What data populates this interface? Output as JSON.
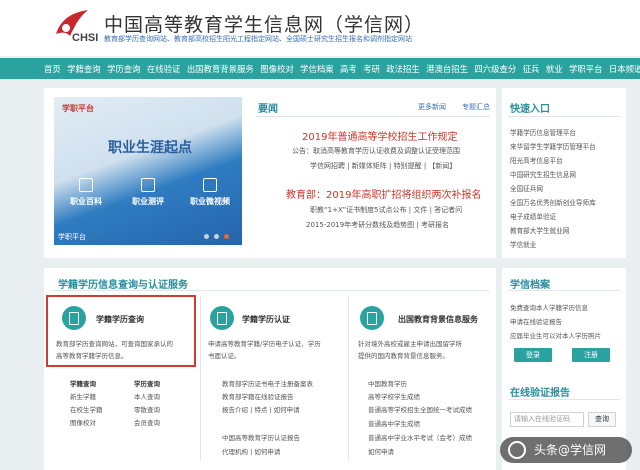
{
  "header": {
    "logo": "CHSI",
    "title": "中国高等教育学生信息网（学信网）",
    "subtitle": "教育部学历查询网站、教育部高校招生阳光工程指定网站、全国硕士研究生招生报名和调剂指定网站"
  },
  "nav": [
    "首页",
    "学籍查询",
    "学历查询",
    "在线验证",
    "出国教育背景服务",
    "图像校对",
    "学信档案",
    "高考",
    "考研",
    "政法招生",
    "港澳台招生",
    "四六级查分",
    "征兵",
    "就业",
    "学职平台",
    "日本频道"
  ],
  "banner": {
    "brand": "学职平台",
    "headline": "职业生涯起点",
    "cards": [
      "职业百科",
      "职业测评",
      "职业微视频"
    ],
    "bottom": "学职平台"
  },
  "news": {
    "title": "要闻",
    "more": "更多新闻",
    "topics": "专题汇总",
    "items": [
      {
        "text": "2019年普通高等学校招生工作规定",
        "style": "red"
      },
      {
        "text": "公告：取消高等教育学历认证收费及调整认证受理范围",
        "style": "dark"
      },
      {
        "text": "学信网招聘 | 新媒体矩阵 | 特别提醒 | 【新闻】",
        "style": "dark"
      },
      {
        "text": "教育部：2019年高职扩招将组织两次补报名",
        "style": "red"
      },
      {
        "text": "职教“1+X”证书制度5试点公布 | 文件 | 答记者问",
        "style": "dark"
      },
      {
        "text": "2015-2019年考研分数线及趋势图 | 考研报名",
        "style": "dark"
      }
    ]
  },
  "quick": {
    "title": "快速入口",
    "items": [
      "学籍学历信息管理平台",
      "来华留学生学籍学历管理平台",
      "阳光高考信息平台",
      "中国研究生招生信息网",
      "全国征兵网",
      "全国万名优秀创新创业导师库",
      "电子成绩单验证",
      "教育部大学生就业网",
      "学信就业"
    ]
  },
  "services": {
    "title": "学籍学历信息查询与认证服务",
    "s1": {
      "title": "学籍学历查询",
      "desc1": "教育部学历查询网站，可查询国家承认的",
      "desc2": "高等教育学籍学历信息。"
    },
    "s2": {
      "title": "学籍学历认证",
      "desc1": "申请高等教育学籍/学历电子认证、学历",
      "desc2": "书面认证。"
    },
    "s3": {
      "title": "出国教育背景信息服务",
      "desc1": "针对境外高校或雇主申请出国留学所",
      "desc2": "提供的国内教育背景信息服务。"
    },
    "col1": [
      "学籍查询",
      "新生学籍",
      "在校生学籍",
      "图像校对"
    ],
    "col2": [
      "学历查询",
      "本人查询",
      "零散查询",
      "会员查询"
    ],
    "s2links": [
      "教育部学历证书电子注册备案表",
      "教育部学籍在线验证报告",
      "报告介绍 | 特点 | 如何申请",
      "中国高等教育学历认证报告",
      "代理机构 | 如何申请"
    ],
    "s3links": [
      "中国教育学历",
      "高等学校学生成绩",
      "普通高等学校招生全国统一考试成绩",
      "普通高中学生成绩",
      "普通高中学业水平考试（会考）成绩",
      "如何申请"
    ]
  },
  "archive": {
    "title": "学信档案",
    "lines": [
      "免费查询本人学籍学历信息",
      "申请在线验证报告",
      "应届毕业生可以对本人学历照片"
    ],
    "login": "登录",
    "register": "注册"
  },
  "verify": {
    "title": "在线验证报告",
    "placeholder": "请输入在线验证码",
    "query": "查询"
  },
  "watermark": "头条@学信网"
}
